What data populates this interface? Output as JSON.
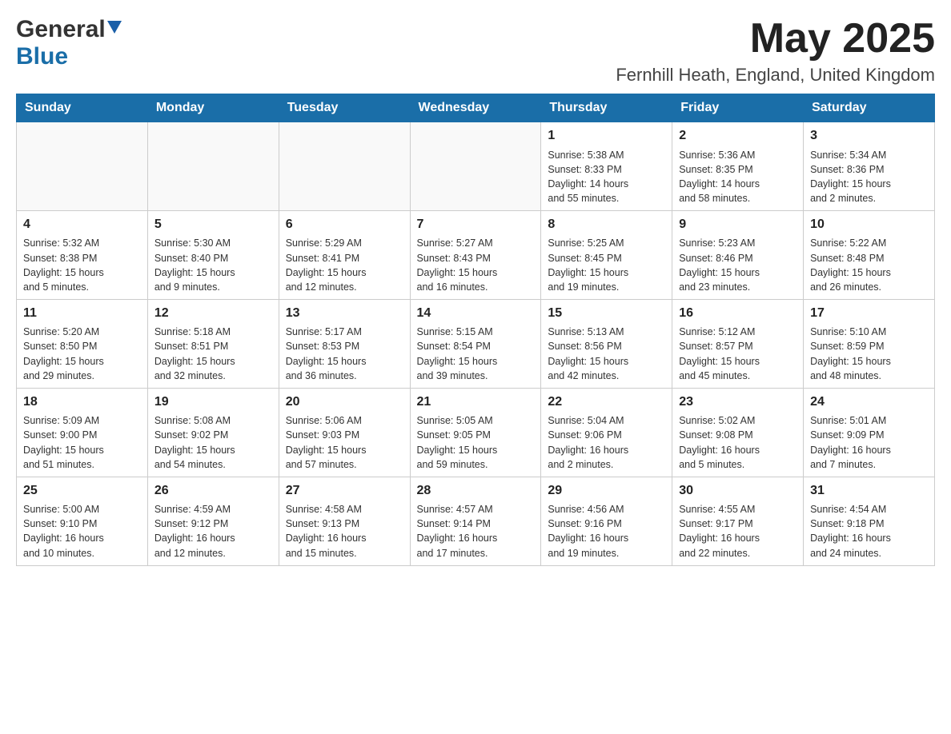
{
  "header": {
    "logo_general": "General",
    "logo_blue": "Blue",
    "month_title": "May 2025",
    "location": "Fernhill Heath, England, United Kingdom"
  },
  "days_of_week": [
    "Sunday",
    "Monday",
    "Tuesday",
    "Wednesday",
    "Thursday",
    "Friday",
    "Saturday"
  ],
  "weeks": [
    [
      {
        "day": "",
        "info": ""
      },
      {
        "day": "",
        "info": ""
      },
      {
        "day": "",
        "info": ""
      },
      {
        "day": "",
        "info": ""
      },
      {
        "day": "1",
        "info": "Sunrise: 5:38 AM\nSunset: 8:33 PM\nDaylight: 14 hours\nand 55 minutes."
      },
      {
        "day": "2",
        "info": "Sunrise: 5:36 AM\nSunset: 8:35 PM\nDaylight: 14 hours\nand 58 minutes."
      },
      {
        "day": "3",
        "info": "Sunrise: 5:34 AM\nSunset: 8:36 PM\nDaylight: 15 hours\nand 2 minutes."
      }
    ],
    [
      {
        "day": "4",
        "info": "Sunrise: 5:32 AM\nSunset: 8:38 PM\nDaylight: 15 hours\nand 5 minutes."
      },
      {
        "day": "5",
        "info": "Sunrise: 5:30 AM\nSunset: 8:40 PM\nDaylight: 15 hours\nand 9 minutes."
      },
      {
        "day": "6",
        "info": "Sunrise: 5:29 AM\nSunset: 8:41 PM\nDaylight: 15 hours\nand 12 minutes."
      },
      {
        "day": "7",
        "info": "Sunrise: 5:27 AM\nSunset: 8:43 PM\nDaylight: 15 hours\nand 16 minutes."
      },
      {
        "day": "8",
        "info": "Sunrise: 5:25 AM\nSunset: 8:45 PM\nDaylight: 15 hours\nand 19 minutes."
      },
      {
        "day": "9",
        "info": "Sunrise: 5:23 AM\nSunset: 8:46 PM\nDaylight: 15 hours\nand 23 minutes."
      },
      {
        "day": "10",
        "info": "Sunrise: 5:22 AM\nSunset: 8:48 PM\nDaylight: 15 hours\nand 26 minutes."
      }
    ],
    [
      {
        "day": "11",
        "info": "Sunrise: 5:20 AM\nSunset: 8:50 PM\nDaylight: 15 hours\nand 29 minutes."
      },
      {
        "day": "12",
        "info": "Sunrise: 5:18 AM\nSunset: 8:51 PM\nDaylight: 15 hours\nand 32 minutes."
      },
      {
        "day": "13",
        "info": "Sunrise: 5:17 AM\nSunset: 8:53 PM\nDaylight: 15 hours\nand 36 minutes."
      },
      {
        "day": "14",
        "info": "Sunrise: 5:15 AM\nSunset: 8:54 PM\nDaylight: 15 hours\nand 39 minutes."
      },
      {
        "day": "15",
        "info": "Sunrise: 5:13 AM\nSunset: 8:56 PM\nDaylight: 15 hours\nand 42 minutes."
      },
      {
        "day": "16",
        "info": "Sunrise: 5:12 AM\nSunset: 8:57 PM\nDaylight: 15 hours\nand 45 minutes."
      },
      {
        "day": "17",
        "info": "Sunrise: 5:10 AM\nSunset: 8:59 PM\nDaylight: 15 hours\nand 48 minutes."
      }
    ],
    [
      {
        "day": "18",
        "info": "Sunrise: 5:09 AM\nSunset: 9:00 PM\nDaylight: 15 hours\nand 51 minutes."
      },
      {
        "day": "19",
        "info": "Sunrise: 5:08 AM\nSunset: 9:02 PM\nDaylight: 15 hours\nand 54 minutes."
      },
      {
        "day": "20",
        "info": "Sunrise: 5:06 AM\nSunset: 9:03 PM\nDaylight: 15 hours\nand 57 minutes."
      },
      {
        "day": "21",
        "info": "Sunrise: 5:05 AM\nSunset: 9:05 PM\nDaylight: 15 hours\nand 59 minutes."
      },
      {
        "day": "22",
        "info": "Sunrise: 5:04 AM\nSunset: 9:06 PM\nDaylight: 16 hours\nand 2 minutes."
      },
      {
        "day": "23",
        "info": "Sunrise: 5:02 AM\nSunset: 9:08 PM\nDaylight: 16 hours\nand 5 minutes."
      },
      {
        "day": "24",
        "info": "Sunrise: 5:01 AM\nSunset: 9:09 PM\nDaylight: 16 hours\nand 7 minutes."
      }
    ],
    [
      {
        "day": "25",
        "info": "Sunrise: 5:00 AM\nSunset: 9:10 PM\nDaylight: 16 hours\nand 10 minutes."
      },
      {
        "day": "26",
        "info": "Sunrise: 4:59 AM\nSunset: 9:12 PM\nDaylight: 16 hours\nand 12 minutes."
      },
      {
        "day": "27",
        "info": "Sunrise: 4:58 AM\nSunset: 9:13 PM\nDaylight: 16 hours\nand 15 minutes."
      },
      {
        "day": "28",
        "info": "Sunrise: 4:57 AM\nSunset: 9:14 PM\nDaylight: 16 hours\nand 17 minutes."
      },
      {
        "day": "29",
        "info": "Sunrise: 4:56 AM\nSunset: 9:16 PM\nDaylight: 16 hours\nand 19 minutes."
      },
      {
        "day": "30",
        "info": "Sunrise: 4:55 AM\nSunset: 9:17 PM\nDaylight: 16 hours\nand 22 minutes."
      },
      {
        "day": "31",
        "info": "Sunrise: 4:54 AM\nSunset: 9:18 PM\nDaylight: 16 hours\nand 24 minutes."
      }
    ]
  ]
}
